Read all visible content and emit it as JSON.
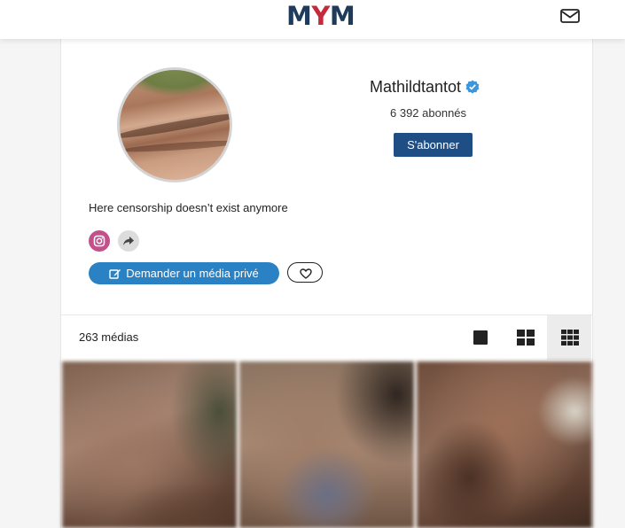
{
  "header": {
    "logo": {
      "m1": "M",
      "y": "Y",
      "m2": "M"
    },
    "mail_icon": "envelope-icon"
  },
  "profile": {
    "username": "Mathildtantot",
    "verified_icon": "verified-badge-icon",
    "subscribers": "6 392 abonnés",
    "subscribe_label": "S'abonner",
    "bio": "Here censorship doesn’t exist anymore",
    "socials": [
      {
        "icon": "instagram-icon"
      },
      {
        "icon": "share-icon"
      }
    ],
    "private_media_label": "Demander un média privé",
    "favorite_icon": "heart-icon"
  },
  "media": {
    "count_label": "263 médias",
    "views": [
      "single-view-icon",
      "grid-2-icon",
      "grid-3-icon"
    ],
    "active_view": "grid-3-icon"
  },
  "colors": {
    "brand_navy": "#1f3b5c",
    "brand_red": "#c42a3c",
    "subscribe_button": "#1f4e84",
    "private_button": "#2a82c4",
    "verified": "#3a96dd",
    "instagram": "#c2508b"
  }
}
